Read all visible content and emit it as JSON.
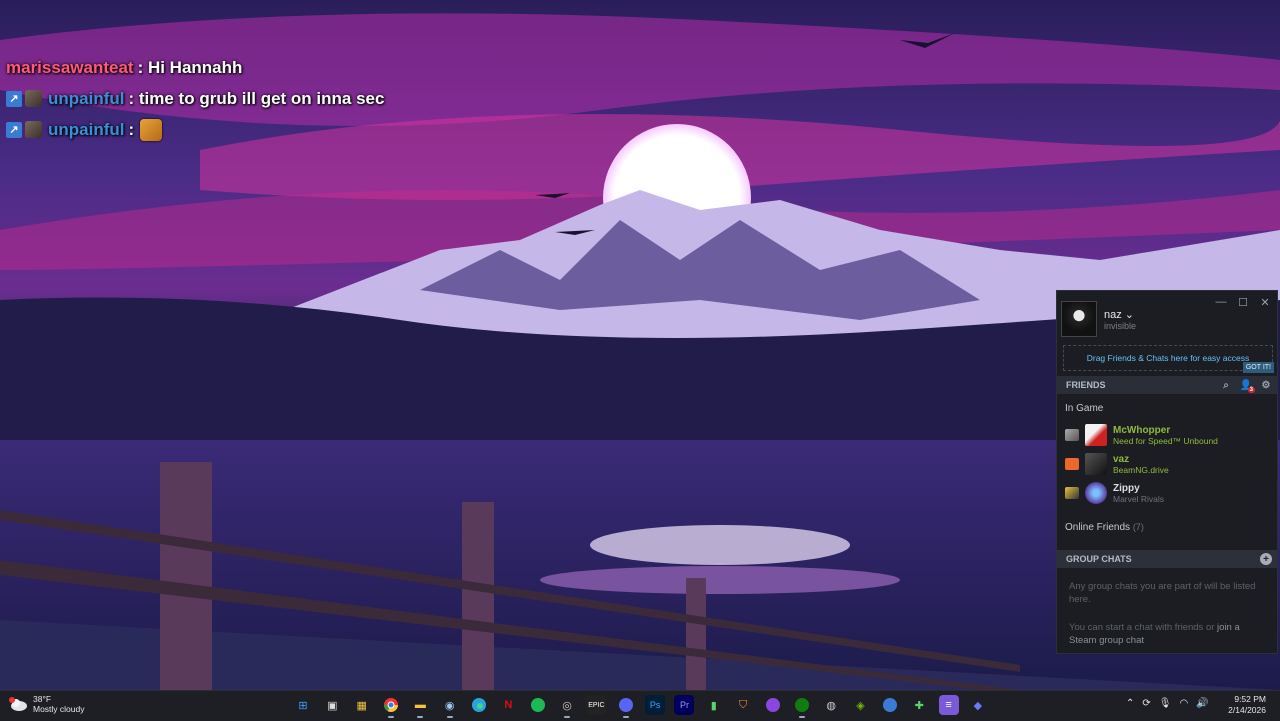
{
  "chat": {
    "messages": [
      {
        "user": "marissawanteat",
        "text": ": Hi Hannahh",
        "color": "#ff5a76"
      },
      {
        "user": "unpainful",
        "text": ": time to grub ill get on inna sec",
        "color": "#3a8fd6"
      },
      {
        "user": "unpainful",
        "text": ":",
        "color": "#3a8fd6"
      }
    ]
  },
  "friends_window": {
    "profile": {
      "name": "naz ⌄",
      "status": "invisible"
    },
    "drag_hint": "Drag Friends & Chats here for easy access",
    "got_it": "GOT IT!",
    "friends_header": "FRIENDS",
    "in_game_label": "In Game",
    "in_game": [
      {
        "name": "McWhopper",
        "game": "Need for Speed™ Unbound"
      },
      {
        "name": "vaz",
        "game": "BeamNG.drive"
      },
      {
        "name": "Zippy",
        "game": "Marvel Rivals"
      }
    ],
    "online_label": "Online Friends",
    "online_count": "(7)",
    "group_chats_header": "GROUP CHATS",
    "group_text_1": "Any group chats you are part of will be listed here.",
    "group_text_2_prefix": "You can start a chat with friends or ",
    "group_text_2_link": "join a Steam group chat",
    "badge_count": "3"
  },
  "taskbar": {
    "weather": {
      "temp": "38°F",
      "condition": "Mostly cloudy"
    },
    "clock": {
      "time": "9:52 PM",
      "date": "2/14/2026"
    },
    "icons": [
      "windows-start",
      "task-view",
      "microsoft-store",
      "chrome",
      "file-explorer",
      "steam",
      "edge",
      "netflix",
      "spotify",
      "obs",
      "epic-games",
      "discord",
      "photoshop",
      "premiere",
      "stats-app",
      "vpn-shield",
      "twitch-like",
      "xbox",
      "chrome-alt",
      "nvidia",
      "qbittorrent",
      "game-editor",
      "notes",
      "media-app"
    ]
  }
}
